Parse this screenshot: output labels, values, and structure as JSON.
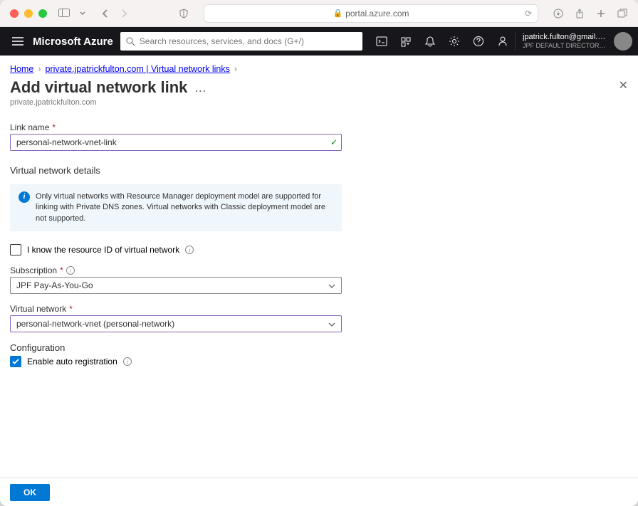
{
  "browser": {
    "url": "portal.azure.com"
  },
  "topnav": {
    "brand": "Microsoft Azure",
    "search_placeholder": "Search resources, services, and docs (G+/)",
    "account_email": "jpatrick.fulton@gmail.c…",
    "account_dir": "JPF DEFAULT DIRECTORY (JPATR…"
  },
  "breadcrumb": {
    "items": [
      "Home",
      "private.jpatrickfulton.com | Virtual network links"
    ]
  },
  "page": {
    "title": "Add virtual network link",
    "subtitle": "private.jpatrickfulton.com"
  },
  "form": {
    "link_name_label": "Link name",
    "link_name_value": "personal-network-vnet-link",
    "vnet_details_title": "Virtual network details",
    "info_text": "Only virtual networks with Resource Manager deployment model are supported for linking with Private DNS zones. Virtual networks with Classic deployment model are not supported.",
    "know_resource_id_label": "I know the resource ID of virtual network",
    "know_resource_id_checked": false,
    "subscription_label": "Subscription",
    "subscription_value": "JPF Pay-As-You-Go",
    "vnet_label": "Virtual network",
    "vnet_value": "personal-network-vnet (personal-network)",
    "config_title": "Configuration",
    "auto_reg_label": "Enable auto registration",
    "auto_reg_checked": true
  },
  "footer": {
    "ok_label": "OK"
  }
}
